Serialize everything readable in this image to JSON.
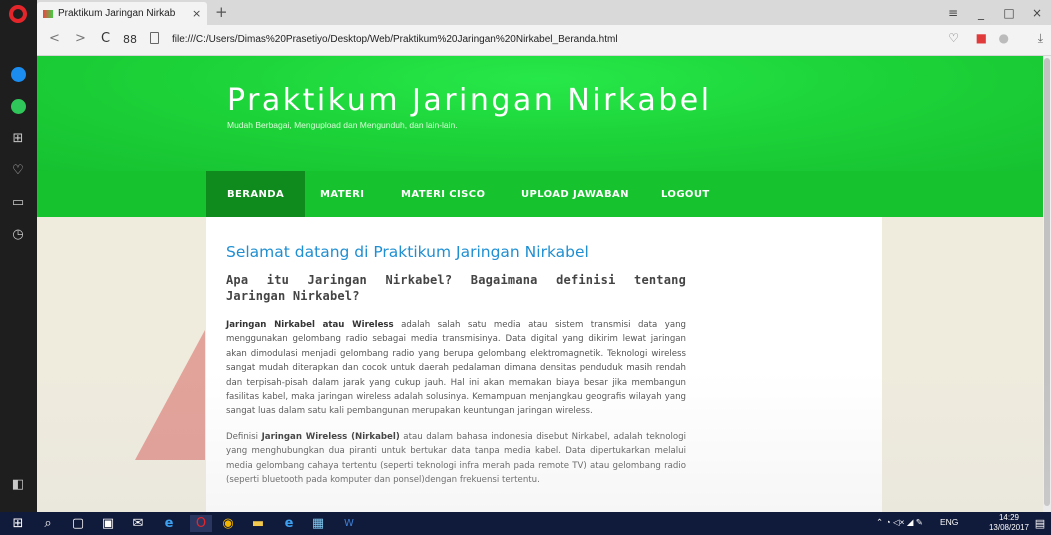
{
  "browser": {
    "tab_title": "Praktikum Jaringan Nirkab",
    "new_tab_symbol": "+",
    "tab_close_symbol": "×",
    "url": "file:///C:/Users/Dimas%20Prasetiyo/Desktop/Web/Praktikum%20Jaringan%20Nirkabel_Beranda.html",
    "speed_dial_label": "88",
    "reload_symbol": "C",
    "back_symbol": "<",
    "forward_symbol": ">",
    "window_controls": [
      "≡",
      "_",
      "□",
      "×"
    ]
  },
  "site": {
    "title": "Praktikum Jaringan Nirkabel",
    "subtitle": "Mudah Berbagai, Mengupload dan Mengunduh, dan lain-lain.",
    "nav": [
      {
        "label": "BERANDA",
        "active": true
      },
      {
        "label": "MATERI",
        "active": false
      },
      {
        "label": "MATERI CISCO",
        "active": false
      },
      {
        "label": "UPLOAD JAWABAN",
        "active": false
      },
      {
        "label": "LOGOUT",
        "active": false
      }
    ],
    "welcome": "Selamat datang di Praktikum Jaringan Nirkabel",
    "question": "Apa itu Jaringan Nirkabel? Bagaimana definisi tentang Jaringan Nirkabel?",
    "para1_bold": "Jaringan Nirkabel atau Wireless",
    "para1_rest": " adalah salah satu media atau sistem transmisi data yang menggunakan gelombang radio sebagai media transmisinya. Data digital yang dikirim lewat jaringan akan dimodulasi menjadi gelombang radio yang berupa gelombang elektromagnetik. Teknologi wireless sangat mudah diterapkan dan cocok untuk daerah pedalaman dimana densitas penduduk masih rendah dan terpisah-pisah dalam jarak yang cukup jauh. Hal ini akan memakan biaya besar jika membangun fasilitas kabel, maka jaringan wireless adalah solusinya. Kemampuan menjangkau geografis wilayah yang sangat luas dalam satu kali pembangunan merupakan keuntungan jaringan wireless.",
    "para2_start": "Definisi ",
    "para2_bold": "Jaringan Wireless (Nirkabel)",
    "para2_rest": " atau dalam bahasa indonesia disebut Nirkabel, adalah teknologi yang menghubungkan dua piranti untuk bertukar data tanpa media kabel. Data dipertukarkan melalui media gelombang cahaya tertentu (seperti teknologi infra merah pada remote TV) atau gelombang radio (seperti bluetooth pada komputer dan ponsel)dengan frekuensi tertentu."
  },
  "taskbar": {
    "language": "ENG",
    "time": "14:29",
    "date": "13/08/2017"
  },
  "colors": {
    "header_green": "#1dd43a",
    "nav_active": "#0f8a1d",
    "welcome_blue": "#1f8fd2"
  }
}
